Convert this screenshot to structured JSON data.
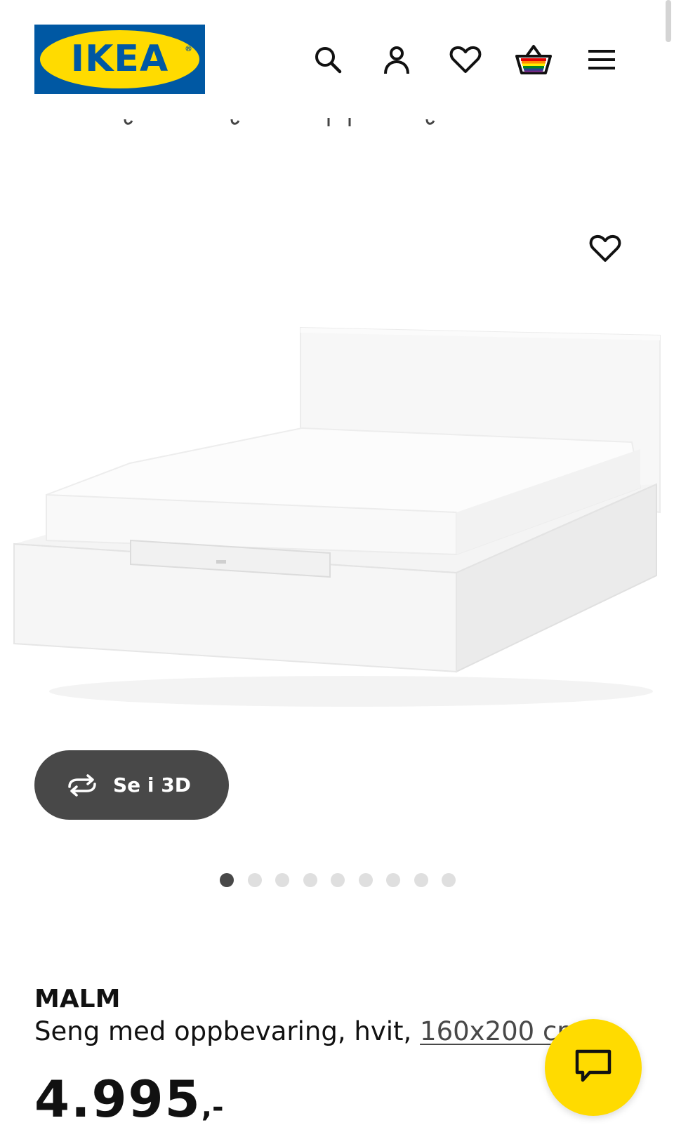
{
  "header": {
    "logo_text": "IKEA",
    "logo_reg": "®",
    "icons": [
      "search-icon",
      "account-icon",
      "wishlist-heart-icon",
      "cart-basket-icon",
      "menu-hamburger-icon"
    ]
  },
  "colors": {
    "brand_blue": "#0058a3",
    "brand_yellow": "#ffdb00",
    "dark_gray": "#484848",
    "dot_inactive": "#dfdfdf"
  },
  "gallery": {
    "view_3d_label": "Se i 3D",
    "dot_count": 9,
    "active_index": 0
  },
  "product": {
    "name": "MALM",
    "description": "Seng med oppbevaring, hvit,",
    "size_link": "160x200 cm",
    "price_main": "4.995",
    "price_suffix": ",-"
  }
}
